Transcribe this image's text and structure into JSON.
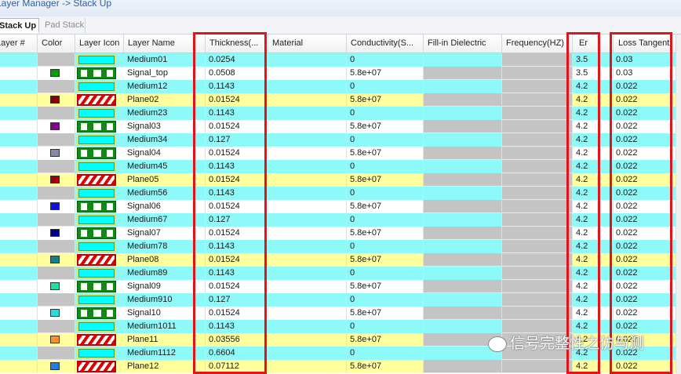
{
  "window": {
    "title": "Layer Manager -> Stack Up"
  },
  "tabs": [
    {
      "label": "Stack Up",
      "active": true
    },
    {
      "label": "Pad Stack",
      "active": false
    }
  ],
  "columns": {
    "layer_no": "Layer #",
    "color": "Color",
    "layer_icon": "Layer Icon",
    "layer_name": "Layer Name",
    "thickness": "Thickness(...",
    "material": "Material",
    "conductivity": "Conductivity(S...",
    "fill_in": "Fill-in Dielectric",
    "frequency": "Frequency(HZ)",
    "er": "Er",
    "loss_tangent": "Loss Tangent"
  },
  "rows": [
    {
      "name": "Medium01",
      "type": "medium",
      "bg": "cyan",
      "color": "",
      "thickness": "0.0254",
      "conductivity": "0",
      "er": "3.5",
      "loss": "0.03"
    },
    {
      "name": "Signal_top",
      "type": "signal",
      "bg": "white",
      "color": "#00a000",
      "thickness": "0.0508",
      "conductivity": "5.8e+07",
      "er": "3.5",
      "loss": "0.03"
    },
    {
      "name": "Medium12",
      "type": "medium",
      "bg": "cyan",
      "color": "",
      "thickness": "0.1143",
      "conductivity": "0",
      "er": "4.2",
      "loss": "0.022"
    },
    {
      "name": "Plane02",
      "type": "plane",
      "bg": "yellow",
      "color": "#8b0000",
      "thickness": "0.01524",
      "conductivity": "5.8e+07",
      "er": "4.2",
      "loss": "0.022"
    },
    {
      "name": "Medium23",
      "type": "medium",
      "bg": "cyan",
      "color": "",
      "thickness": "0.1143",
      "conductivity": "0",
      "er": "4.2",
      "loss": "0.022"
    },
    {
      "name": "Signal03",
      "type": "signal",
      "bg": "white",
      "color": "#8a0090",
      "thickness": "0.01524",
      "conductivity": "5.8e+07",
      "er": "4.2",
      "loss": "0.022"
    },
    {
      "name": "Medium34",
      "type": "medium",
      "bg": "cyan",
      "color": "",
      "thickness": "0.127",
      "conductivity": "0",
      "er": "4.2",
      "loss": "0.022"
    },
    {
      "name": "Signal04",
      "type": "signal",
      "bg": "white",
      "color": "#8888aa",
      "thickness": "0.01524",
      "conductivity": "5.8e+07",
      "er": "4.2",
      "loss": "0.022"
    },
    {
      "name": "Medium45",
      "type": "medium",
      "bg": "cyan",
      "color": "",
      "thickness": "0.1143",
      "conductivity": "0",
      "er": "4.2",
      "loss": "0.022"
    },
    {
      "name": "Plane05",
      "type": "plane",
      "bg": "yellow",
      "color": "#a00010",
      "thickness": "0.01524",
      "conductivity": "5.8e+07",
      "er": "4.2",
      "loss": "0.022"
    },
    {
      "name": "Medium56",
      "type": "medium",
      "bg": "cyan",
      "color": "",
      "thickness": "0.1143",
      "conductivity": "0",
      "er": "4.2",
      "loss": "0.022"
    },
    {
      "name": "Signal06",
      "type": "signal",
      "bg": "white",
      "color": "#1010e0",
      "thickness": "0.01524",
      "conductivity": "5.8e+07",
      "er": "4.2",
      "loss": "0.022"
    },
    {
      "name": "Medium67",
      "type": "medium",
      "bg": "cyan",
      "color": "",
      "thickness": "0.127",
      "conductivity": "0",
      "er": "4.2",
      "loss": "0.022"
    },
    {
      "name": "Signal07",
      "type": "signal",
      "bg": "white",
      "color": "#000090",
      "thickness": "0.01524",
      "conductivity": "5.8e+07",
      "er": "4.2",
      "loss": "0.022"
    },
    {
      "name": "Medium78",
      "type": "medium",
      "bg": "cyan",
      "color": "",
      "thickness": "0.1143",
      "conductivity": "0",
      "er": "4.2",
      "loss": "0.022"
    },
    {
      "name": "Plane08",
      "type": "plane",
      "bg": "yellow",
      "color": "#10808a",
      "thickness": "0.01524",
      "conductivity": "5.8e+07",
      "er": "4.2",
      "loss": "0.022"
    },
    {
      "name": "Medium89",
      "type": "medium",
      "bg": "cyan",
      "color": "",
      "thickness": "0.1143",
      "conductivity": "0",
      "er": "4.2",
      "loss": "0.022"
    },
    {
      "name": "Signal09",
      "type": "signal",
      "bg": "white",
      "color": "#20e0a0",
      "thickness": "0.01524",
      "conductivity": "5.8e+07",
      "er": "4.2",
      "loss": "0.022"
    },
    {
      "name": "Medium910",
      "type": "medium",
      "bg": "cyan",
      "color": "",
      "thickness": "0.127",
      "conductivity": "0",
      "er": "4.2",
      "loss": "0.022"
    },
    {
      "name": "Signal10",
      "type": "signal",
      "bg": "white",
      "color": "#20e0e0",
      "thickness": "0.01524",
      "conductivity": "5.8e+07",
      "er": "4.2",
      "loss": "0.022"
    },
    {
      "name": "Medium1011",
      "type": "medium",
      "bg": "cyan",
      "color": "",
      "thickness": "0.1143",
      "conductivity": "0",
      "er": "4.2",
      "loss": "0.022"
    },
    {
      "name": "Plane11",
      "type": "plane",
      "bg": "yellow",
      "color": "#ff9020",
      "thickness": "0.03556",
      "conductivity": "5.8e+07",
      "er": "4.2",
      "loss": "0.022"
    },
    {
      "name": "Medium1112",
      "type": "medium",
      "bg": "cyan",
      "color": "",
      "thickness": "0.6604",
      "conductivity": "0",
      "er": "4.2",
      "loss": "0.022"
    },
    {
      "name": "Plane12",
      "type": "plane",
      "bg": "yellow",
      "color": "#2080e0",
      "thickness": "0.07112",
      "conductivity": "5.8e+07",
      "er": "4.2",
      "loss": "0.022"
    }
  ],
  "watermark": {
    "text": "信号完整性之仿与测"
  }
}
